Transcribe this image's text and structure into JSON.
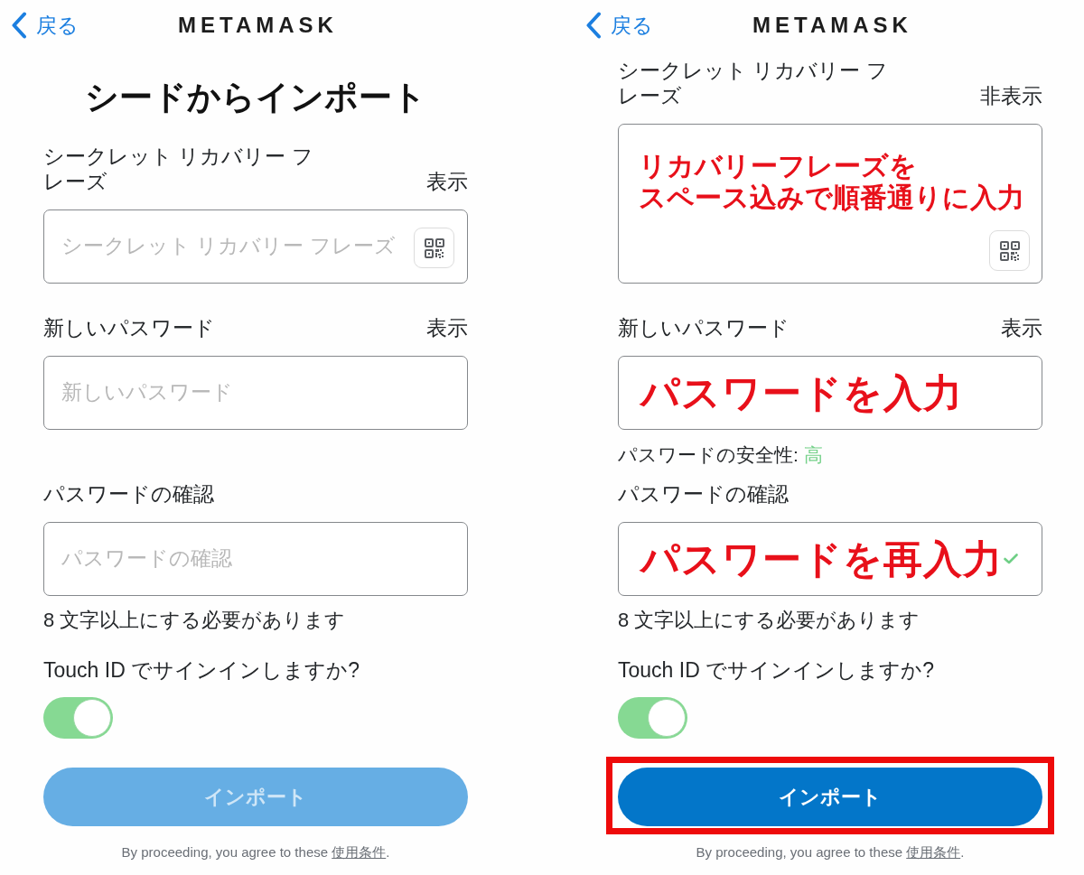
{
  "screens": [
    {
      "header": {
        "back_label": "戻る",
        "title": "METAMASK"
      },
      "heading": "シードからインポート",
      "phrase": {
        "label": "シークレット リカバリー フレーズ",
        "toggle_label": "表示",
        "placeholder": "シークレット リカバリー フレーズ",
        "multiline": false
      },
      "new_password": {
        "label": "新しいパスワード",
        "toggle_label": "表示",
        "placeholder": "新しいパスワード"
      },
      "confirm_password": {
        "label": "パスワードの確認",
        "placeholder": "パスワードの確認",
        "valid": false
      },
      "hint": "8 文字以上にする必要があります",
      "touch_id": {
        "label": "Touch ID でサインインしますか?",
        "on": true
      },
      "import_button": {
        "label": "インポート",
        "disabled": true,
        "highlighted": false
      },
      "footer": {
        "text": "By proceeding, you agree to these",
        "link": "使用条件",
        "end": "."
      }
    },
    {
      "header": {
        "back_label": "戻る",
        "title": "METAMASK"
      },
      "phrase": {
        "label": "シークレット リカバリー フレーズ",
        "toggle_label": "非表示",
        "annotation_lines": [
          "リカバリーフレーズを",
          "スペース込みで順番通りに入力"
        ],
        "multiline": true
      },
      "new_password": {
        "label": "新しいパスワード",
        "toggle_label": "表示",
        "annotation": "パスワードを入力",
        "strength": {
          "label": "パスワードの安全性:",
          "value": "高"
        }
      },
      "confirm_password": {
        "label": "パスワードの確認",
        "annotation": "パスワードを再入力",
        "valid": true
      },
      "hint": "8 文字以上にする必要があります",
      "touch_id": {
        "label": "Touch ID でサインインしますか?",
        "on": true
      },
      "import_button": {
        "label": "インポート",
        "disabled": false,
        "highlighted": true
      },
      "footer": {
        "text": "By proceeding, you agree to these",
        "link": "使用条件",
        "end": "."
      }
    }
  ]
}
